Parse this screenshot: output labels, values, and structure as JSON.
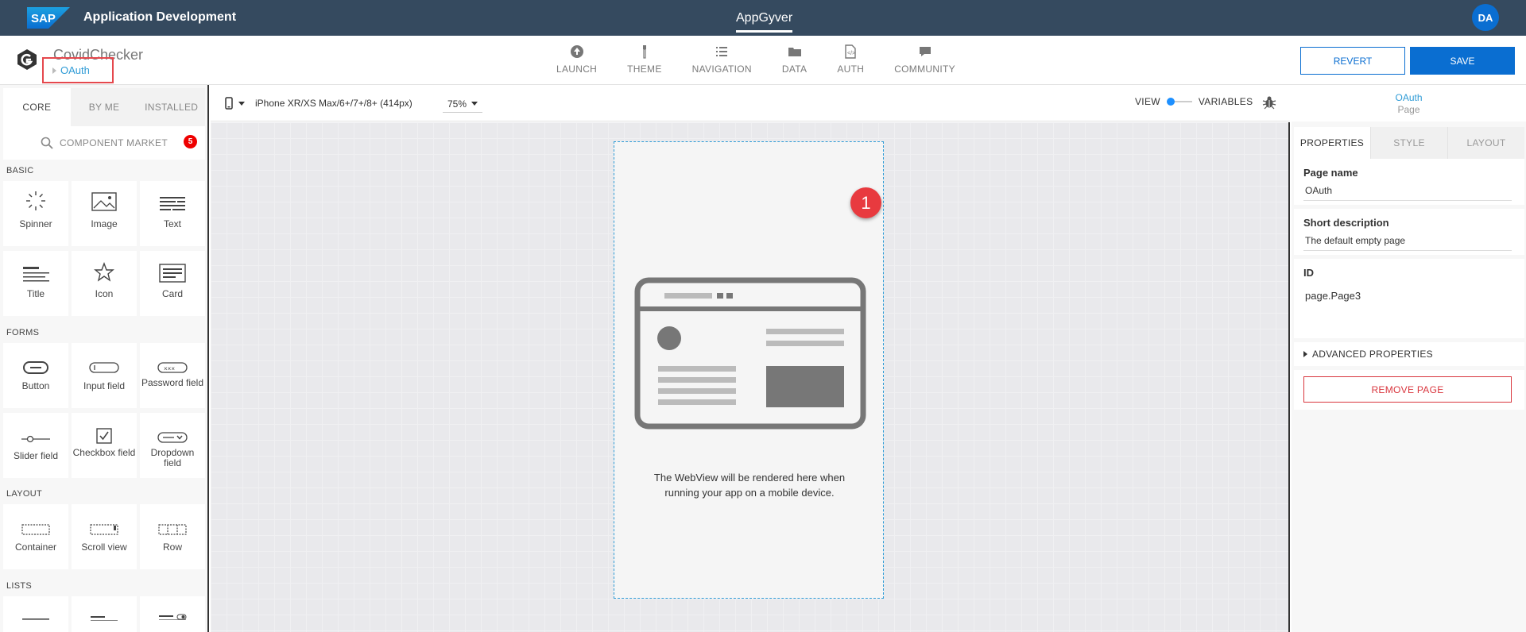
{
  "shell": {
    "logo_text": "SAP",
    "title": "Application Development",
    "center": "AppGyver",
    "avatar": "DA"
  },
  "header": {
    "project_name": "CovidChecker",
    "breadcrumb": "OAuth",
    "nav": [
      {
        "label": "LAUNCH",
        "icon": "launch-icon"
      },
      {
        "label": "THEME",
        "icon": "theme-icon"
      },
      {
        "label": "NAVIGATION",
        "icon": "navigation-icon"
      },
      {
        "label": "DATA",
        "icon": "data-folder-icon"
      },
      {
        "label": "AUTH",
        "icon": "auth-icon"
      },
      {
        "label": "COMMUNITY",
        "icon": "community-icon"
      }
    ],
    "revert_label": "REVERT",
    "save_label": "SAVE"
  },
  "left": {
    "tabs": [
      "CORE",
      "BY ME",
      "INSTALLED"
    ],
    "active_tab": "CORE",
    "market_label": "COMPONENT MARKET",
    "market_badge": "5",
    "sections": {
      "basic": "BASIC",
      "forms": "FORMS",
      "layout": "LAYOUT",
      "lists": "LISTS"
    },
    "basic": [
      "Spinner",
      "Image",
      "Text",
      "Title",
      "Icon",
      "Card"
    ],
    "forms": [
      "Button",
      "Input field",
      "Password field",
      "Slider field",
      "Checkbox field",
      "Dropdown field"
    ],
    "layout": [
      "Container",
      "Scroll view",
      "Row"
    ]
  },
  "canvas": {
    "device": "iPhone XR/XS Max/6+/7+/8+ (414px)",
    "zoom": "75%",
    "view_label": "VIEW",
    "variables_label": "VARIABLES",
    "marker": "1",
    "message_line1": "The WebView will be rendered here when",
    "message_line2": "running your app on a mobile device."
  },
  "right": {
    "title": "OAuth",
    "subtitle": "Page",
    "tabs": [
      "PROPERTIES",
      "STYLE",
      "LAYOUT"
    ],
    "active_tab": "PROPERTIES",
    "page_name_label": "Page name",
    "page_name_value": "OAuth",
    "short_desc_label": "Short description",
    "short_desc_value": "The default empty page",
    "id_label": "ID",
    "id_value": "page.Page3",
    "advanced_label": "ADVANCED PROPERTIES",
    "remove_label": "REMOVE PAGE"
  },
  "colors": {
    "shell_bg": "#354a5f",
    "primary": "#0a6ed1",
    "link": "#2e9bd6",
    "danger": "#d9363e",
    "highlight": "#e5484d"
  }
}
